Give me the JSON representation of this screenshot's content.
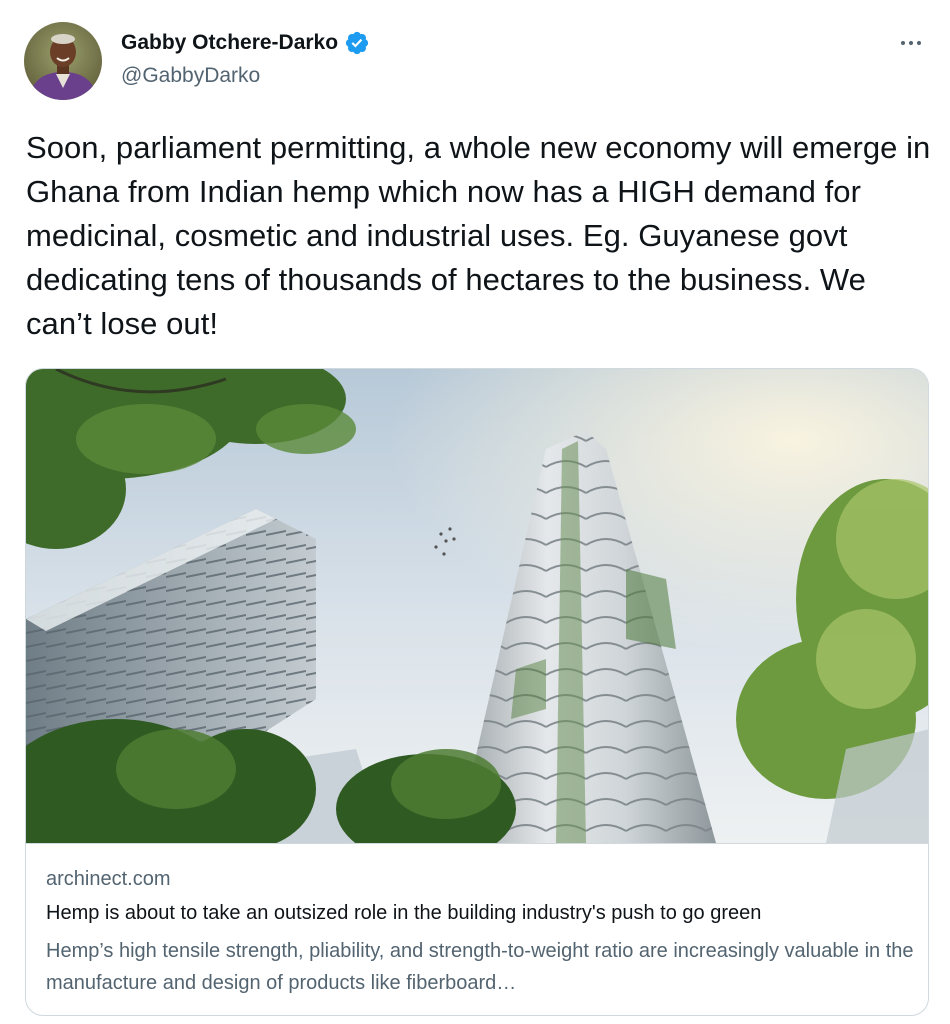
{
  "author": {
    "display_name": "Gabby Otchere-Darko",
    "handle": "@GabbyDarko",
    "verified": true,
    "verified_icon": "verified-badge-icon",
    "avatar_icon": "avatar"
  },
  "more_icon": "more-options-icon",
  "tweet": {
    "text": "Soon, parliament permitting, a whole new economy will emerge in Ghana from Indian hemp which now has a HIGH demand for medicinal, cosmetic and industrial uses.  Eg. Guyanese govt dedicating tens of thousands of hectares to the business. We can’t lose out!"
  },
  "card": {
    "domain": "archinect.com",
    "title": "Hemp is about to take an outsized role in the building industry's push to go green",
    "description": "Hemp’s high tensile strength, pliability, and strength-to-weight ratio are increasingly valuable in the manufacture and design of products like fiberboard…"
  },
  "colors": {
    "text_primary": "#0f1419",
    "text_secondary": "#536471",
    "verified_blue": "#1d9bf0",
    "border": "#cfd9de"
  }
}
